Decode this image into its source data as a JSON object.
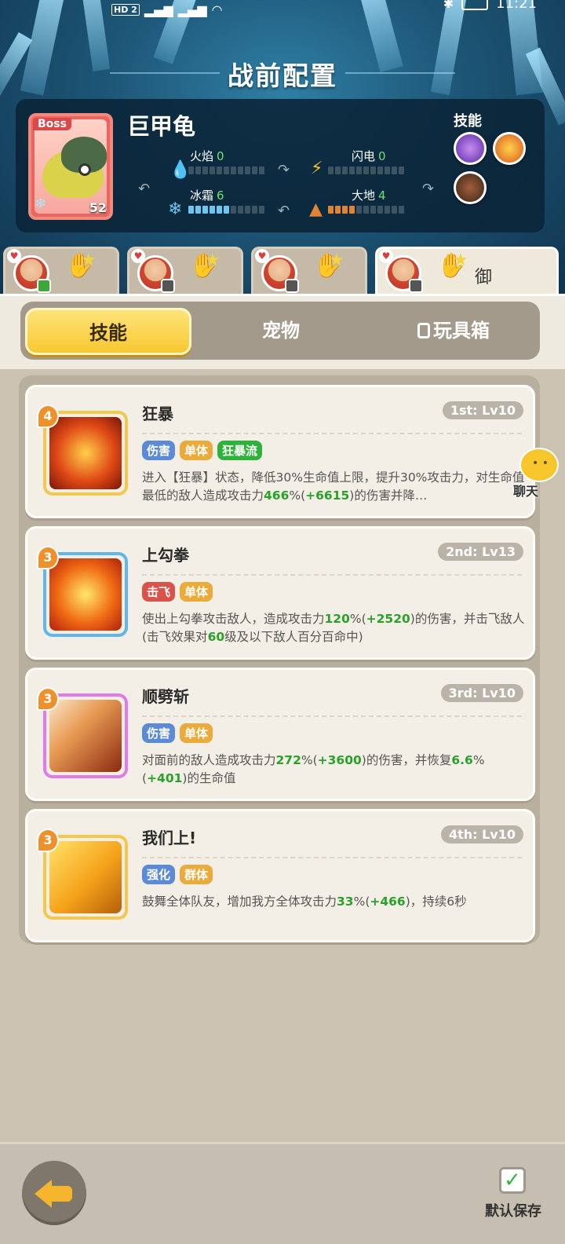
{
  "status_bar": {
    "network": "HD 2",
    "time": "11:21"
  },
  "title": "战前配置",
  "boss": {
    "tag": "Boss",
    "name": "巨甲龟",
    "level": "52",
    "attributes": [
      {
        "label": "火焰",
        "value": "0",
        "fill": 0
      },
      {
        "label": "闪电",
        "value": "0",
        "fill": 0
      },
      {
        "label": "冰霜",
        "value": "6",
        "fill": 6
      },
      {
        "label": "大地",
        "value": "4",
        "fill": 4
      }
    ],
    "skills_label": "技能",
    "skill_icons": [
      "purple-swirl-icon",
      "fire-crown-icon",
      "dark-beast-icon"
    ]
  },
  "hero_tabs": [
    {
      "name": "hero-1",
      "extra": ""
    },
    {
      "name": "hero-2",
      "extra": ""
    },
    {
      "name": "hero-3",
      "extra": ""
    },
    {
      "name": "hero-4",
      "extra": "御"
    }
  ],
  "tabs": {
    "skills": "技能",
    "pets": "宠物",
    "toybox": "玩具箱"
  },
  "skills": [
    {
      "rank": "4",
      "name": "狂暴",
      "level": "1st: Lv10",
      "tags": [
        {
          "text": "伤害",
          "color": "blue"
        },
        {
          "text": "单体",
          "color": "orange"
        },
        {
          "text": "狂暴流",
          "color": "green"
        }
      ],
      "desc_parts": [
        {
          "t": "进入【狂暴】状态，降低30%生命值上限，提升30%攻击力，对生命值最低的敌人造成攻击力",
          "g": false
        },
        {
          "t": "466",
          "g": true
        },
        {
          "t": "%(",
          "g": false
        },
        {
          "t": "+6615",
          "g": true
        },
        {
          "t": ")的伤害并降…",
          "g": false
        }
      ]
    },
    {
      "rank": "3",
      "name": "上勾拳",
      "level": "2nd: Lv13",
      "tags": [
        {
          "text": "击飞",
          "color": "red"
        },
        {
          "text": "单体",
          "color": "orange"
        }
      ],
      "desc_parts": [
        {
          "t": "使出上勾拳攻击敌人，造成攻击力",
          "g": false
        },
        {
          "t": "120",
          "g": true
        },
        {
          "t": "%(",
          "g": false
        },
        {
          "t": "+2520",
          "g": true
        },
        {
          "t": ")的伤害，并击飞敌人(击飞效果对",
          "g": false
        },
        {
          "t": "60",
          "g": true
        },
        {
          "t": "级及以下敌人百分百命中)",
          "g": false
        }
      ]
    },
    {
      "rank": "3",
      "name": "顺劈斩",
      "level": "3rd: Lv10",
      "tags": [
        {
          "text": "伤害",
          "color": "blue"
        },
        {
          "text": "单体",
          "color": "orange"
        }
      ],
      "desc_parts": [
        {
          "t": "对面前的敌人造成攻击力",
          "g": false
        },
        {
          "t": "272",
          "g": true
        },
        {
          "t": "%(",
          "g": false
        },
        {
          "t": "+3600",
          "g": true
        },
        {
          "t": ")的伤害，并恢复",
          "g": false
        },
        {
          "t": "6.6",
          "g": true
        },
        {
          "t": "%(",
          "g": false
        },
        {
          "t": "+401",
          "g": true
        },
        {
          "t": ")的生命值",
          "g": false
        }
      ]
    },
    {
      "rank": "3",
      "name": "我们上!",
      "level": "4th: Lv10",
      "tags": [
        {
          "text": "强化",
          "color": "blue"
        },
        {
          "text": "群体",
          "color": "orange"
        }
      ],
      "desc_parts": [
        {
          "t": "鼓舞全体队友，增加我方全体攻击力",
          "g": false
        },
        {
          "t": "33",
          "g": true
        },
        {
          "t": "%(",
          "g": false
        },
        {
          "t": "+466",
          "g": true
        },
        {
          "t": ")，持续6秒",
          "g": false
        }
      ]
    }
  ],
  "chat_label": "聊天",
  "bottom": {
    "save_label": "默认保存"
  }
}
